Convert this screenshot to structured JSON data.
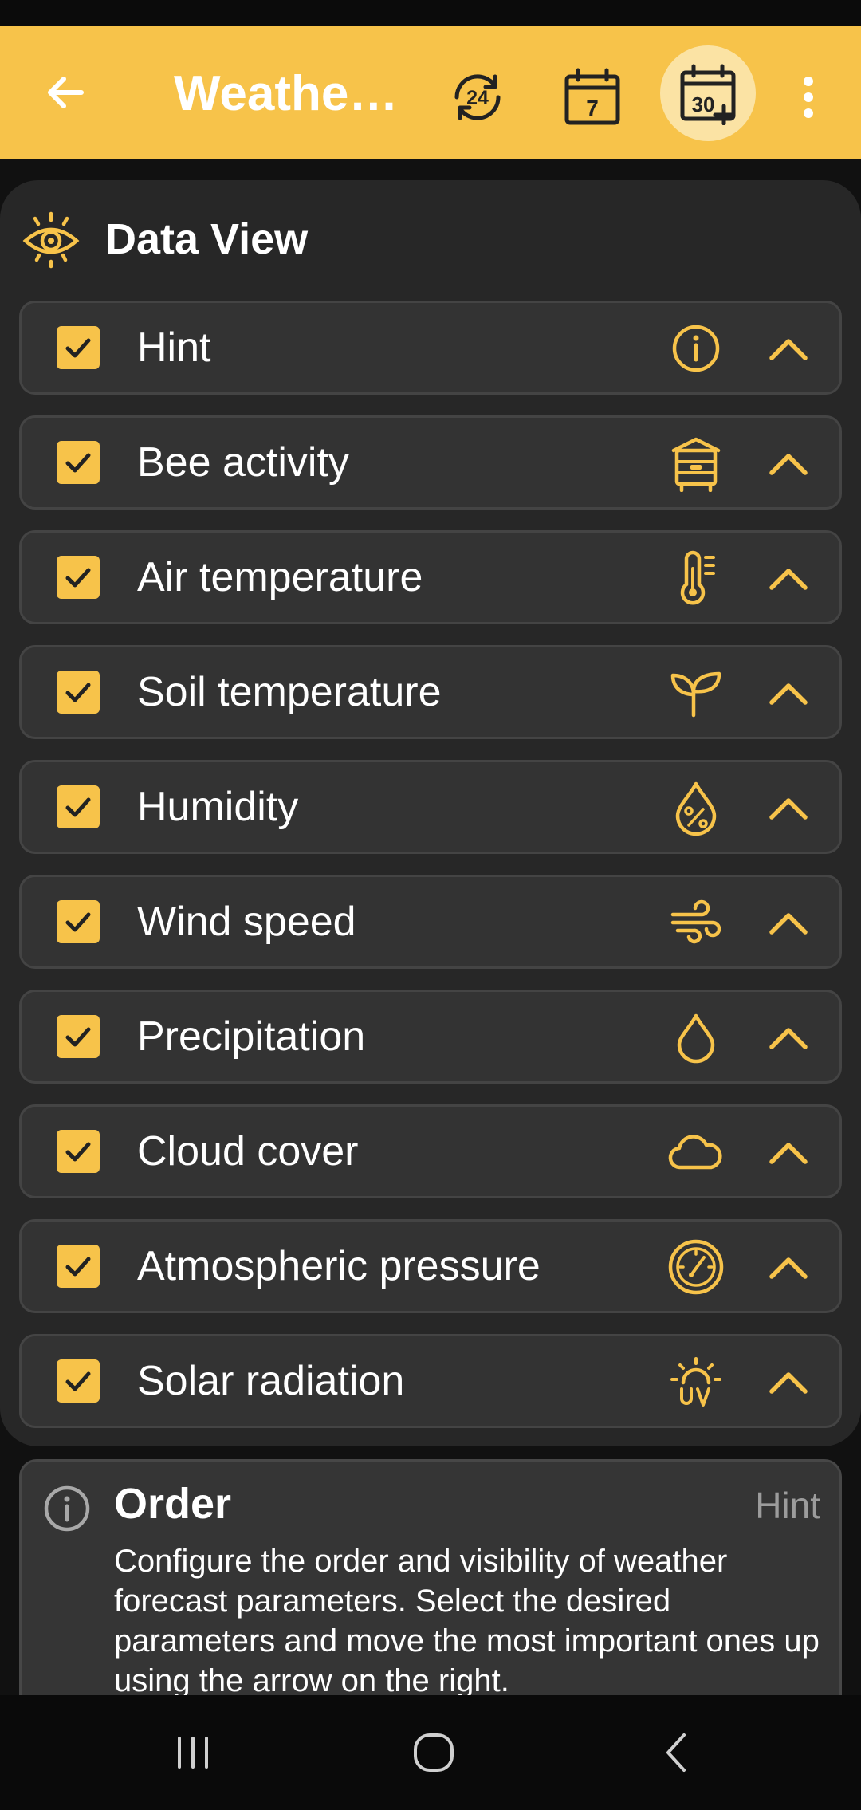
{
  "appbar": {
    "title": "Weathe…",
    "colors": {
      "accent": "#F7C34A",
      "selected_bg": "#FBE3A4",
      "icon": "#222222"
    },
    "btn_24": "24",
    "btn_7": "7",
    "btn_30": "30"
  },
  "panel": {
    "title": "Data View",
    "icon": "eye-icon"
  },
  "items": [
    {
      "label": "Hint",
      "checked": true,
      "icon": "info-icon"
    },
    {
      "label": "Bee activity",
      "checked": true,
      "icon": "beehive-icon"
    },
    {
      "label": "Air temperature",
      "checked": true,
      "icon": "thermometer-icon"
    },
    {
      "label": "Soil temperature",
      "checked": true,
      "icon": "sprout-icon"
    },
    {
      "label": "Humidity",
      "checked": true,
      "icon": "humidity-drop-icon"
    },
    {
      "label": "Wind speed",
      "checked": true,
      "icon": "wind-icon"
    },
    {
      "label": "Precipitation",
      "checked": true,
      "icon": "drop-icon"
    },
    {
      "label": "Cloud cover",
      "checked": true,
      "icon": "cloud-icon"
    },
    {
      "label": "Atmospheric pressure",
      "checked": true,
      "icon": "gauge-icon"
    },
    {
      "label": "Solar radiation",
      "checked": true,
      "icon": "uv-sun-icon"
    }
  ],
  "hint": {
    "title": "Order",
    "tag": "Hint",
    "text": "Configure the order and visibility of weather forecast parameters. Select the desired parameters and move the most important ones up using the arrow on the right."
  }
}
